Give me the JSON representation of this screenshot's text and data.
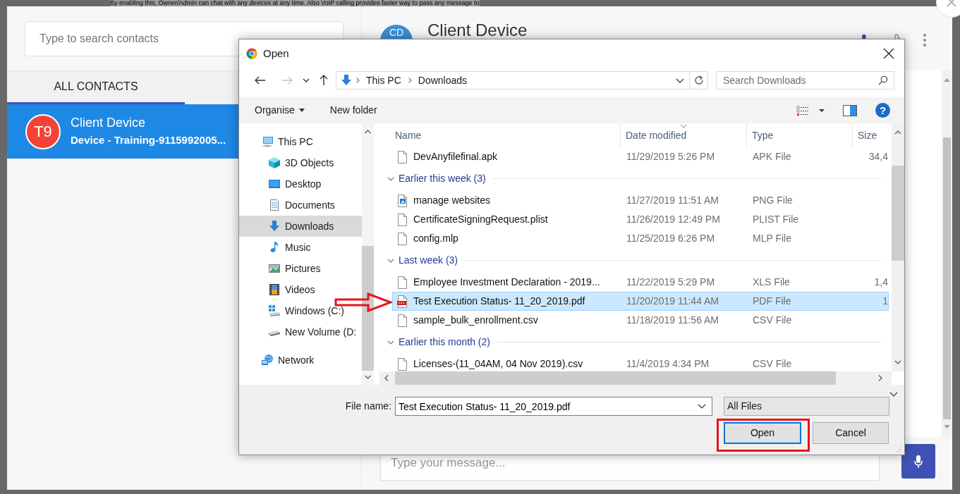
{
  "page_notice": "By enabling this, Owner/Admin can chat with any devices at any time. Also VoIP calling provides faster way to pass any message to",
  "contacts": {
    "search": {
      "placeholder": "Type to search contacts"
    },
    "tabs": [
      {
        "label": "ALL CONTACTS",
        "selected": true
      }
    ],
    "items": [
      {
        "initials": "T9",
        "name": "Client Device",
        "subtitle": "Device - Training-9115992005...",
        "selected": true
      }
    ]
  },
  "chat": {
    "initials": "CD",
    "title": "Client Device",
    "message": {
      "placeholder": "Type your message..."
    }
  },
  "dialog": {
    "title": "Open",
    "nav_buttons": [
      {
        "kind": "back",
        "disabled": false
      },
      {
        "kind": "forward",
        "disabled": true
      },
      {
        "kind": "recent",
        "disabled": false
      },
      {
        "kind": "up",
        "disabled": false
      }
    ],
    "address": [
      "This PC",
      "Downloads"
    ],
    "search": {
      "placeholder": "Search Downloads"
    },
    "toolbar": [
      {
        "label": "Organise",
        "dropdown": true
      },
      {
        "label": "New folder",
        "dropdown": false
      }
    ],
    "help": {
      "label": "?"
    },
    "nav": [
      {
        "label": "This PC",
        "kind": "computer",
        "selected": false,
        "children": [
          {
            "label": "3D Objects",
            "kind": "cube",
            "selected": false
          },
          {
            "label": "Desktop",
            "kind": "desktop",
            "selected": false
          },
          {
            "label": "Documents",
            "kind": "document",
            "selected": false
          },
          {
            "label": "Downloads",
            "kind": "download",
            "selected": true
          },
          {
            "label": "Music",
            "kind": "music",
            "selected": false
          },
          {
            "label": "Pictures",
            "kind": "pictures",
            "selected": false
          },
          {
            "label": "Videos",
            "kind": "videos",
            "selected": false
          },
          {
            "label": "Windows (C:)",
            "kind": "drive-windows",
            "selected": false
          },
          {
            "label": "New Volume (D:",
            "kind": "drive",
            "selected": false
          }
        ]
      },
      {
        "label": "Network",
        "kind": "network",
        "selected": false
      }
    ],
    "columns": [
      {
        "label": "Name",
        "sorted": false
      },
      {
        "label": "Date modified",
        "sorted": true
      },
      {
        "label": "Type",
        "sorted": false
      },
      {
        "label": "Size",
        "sorted": false
      }
    ],
    "rows": [
      {
        "kind": "file",
        "name": "DevAnyfilefinal.apk",
        "date": "11/29/2019 5:26 PM",
        "type": "APK File",
        "size": "34,4",
        "selected": false
      },
      {
        "kind": "group",
        "label": "Earlier this week (3)",
        "expanded": true
      },
      {
        "kind": "image",
        "name": "manage websites",
        "date": "11/27/2019 11:51 AM",
        "type": "PNG File",
        "selected": false
      },
      {
        "kind": "file",
        "name": "CertificateSigningRequest.plist",
        "date": "11/26/2019 12:49 PM",
        "type": "PLIST File",
        "selected": false
      },
      {
        "kind": "file",
        "name": "config.mlp",
        "date": "11/25/2019 6:26 PM",
        "type": "MLP File",
        "selected": false
      },
      {
        "kind": "group",
        "label": "Last week (3)",
        "expanded": true
      },
      {
        "kind": "file",
        "name": "Employee Investment Declaration - 2019...",
        "date": "11/22/2019 5:29 PM",
        "type": "XLS File",
        "size": "1,4",
        "selected": false
      },
      {
        "kind": "pdf",
        "name": "Test Execution Status- 11_20_2019.pdf",
        "date": "11/20/2019 11:44 AM",
        "type": "PDF File",
        "size": "1",
        "selected": true
      },
      {
        "kind": "file",
        "name": "sample_bulk_enrollment.csv",
        "date": "11/18/2019 11:56 AM",
        "type": "CSV File",
        "selected": false
      },
      {
        "kind": "group",
        "label": "Earlier this month (2)",
        "expanded": true
      },
      {
        "kind": "file",
        "name": "Licenses-(11_04AM, 04 Nov 2019).csv",
        "date": "11/4/2019 4:34 PM",
        "type": "CSV File",
        "selected": false
      }
    ],
    "file_name": {
      "label": "File name:",
      "value": "Test Execution Status- 11_20_2019.pdf"
    },
    "filter": "All Files",
    "buttons": [
      {
        "label": "Open",
        "default": true
      },
      {
        "label": "Cancel",
        "default": false
      }
    ]
  }
}
